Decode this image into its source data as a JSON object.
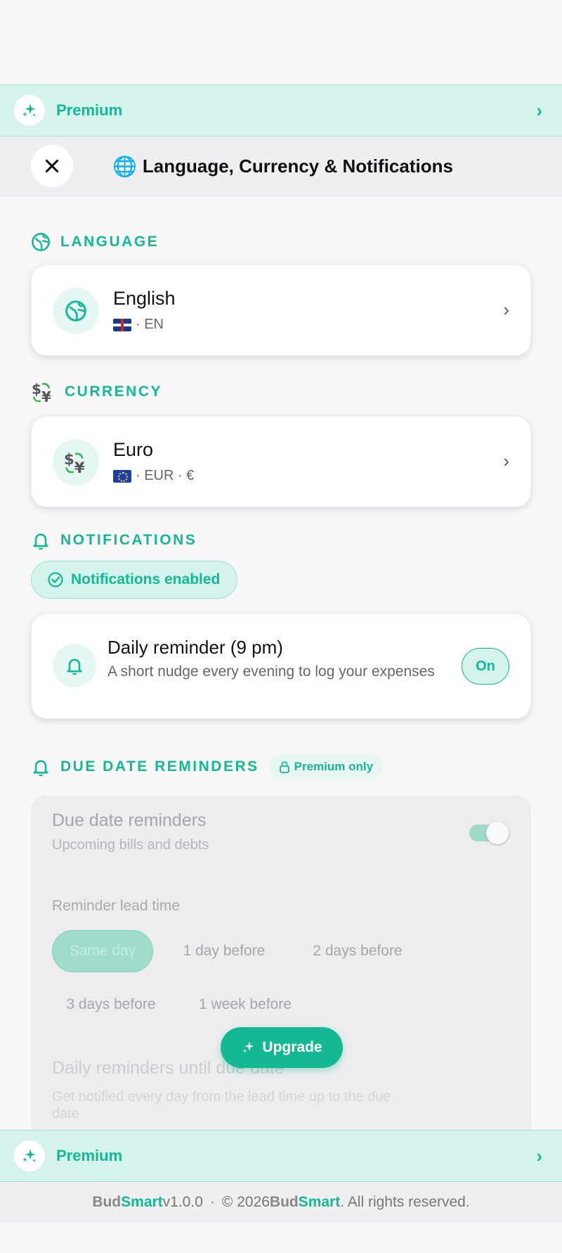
{
  "premium_bar": {
    "label": "Premium",
    "icon": "sparkle-icon",
    "chevron": "›"
  },
  "header": {
    "title": "Language, Currency & Notifications",
    "globe": "🌐"
  },
  "language": {
    "section_label": "LANGUAGE",
    "name": "English",
    "code": "· EN",
    "chevron": "›"
  },
  "currency": {
    "section_label": "CURRENCY",
    "name": "Euro",
    "code": "· EUR · €",
    "chevron": "›"
  },
  "notifications": {
    "section_label": "NOTIFICATIONS",
    "status": "Notifications enabled",
    "daily": {
      "title": "Daily reminder (9 pm)",
      "subtitle": "A short nudge every evening to log your expenses",
      "state": "On"
    }
  },
  "due_dates": {
    "section_label": "DUE DATE REMINDERS",
    "badge": "Premium only",
    "title": "Due date reminders",
    "subtitle": "Upcoming bills and debts",
    "lead_time_label": "Reminder lead time",
    "lead_times": [
      "Same day",
      "1 day before",
      "2 days before",
      "3 days before",
      "1 week before"
    ],
    "selected_lead_time": "Same day",
    "daily_until_title": "Daily reminders until due date",
    "daily_until_sub_1": "Get notified every day from the lead time up to the due",
    "daily_until_sub_2": "date"
  },
  "upgrade_label": "Upgrade",
  "footer": {
    "bud": "Bud",
    "smart": "Smart",
    "version": " v1.0.0",
    "sep": "·",
    "copyright": "© 2026 ",
    "bud2": "Bud",
    "smart2": "Smart",
    "rights": ". All rights reserved."
  },
  "colors": {
    "accent": "#14b893",
    "accent_light": "#d4f3ec"
  }
}
